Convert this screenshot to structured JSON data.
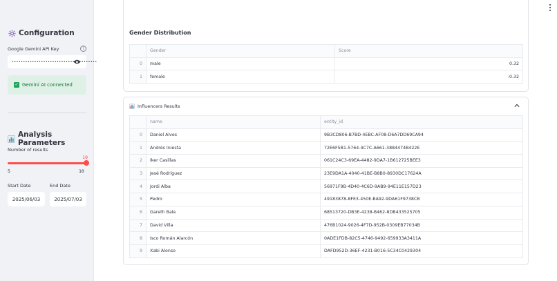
{
  "sidebar": {
    "config_title": "Configuration",
    "config_icon": "gear-icon",
    "api_label": "Google Gemini API Key",
    "api_value_masked": "••••••••••••••••••••••••••••••••••••••",
    "status_text": "Gemini AI connected",
    "params_title": "Analysis Parameters",
    "params_icon": "bar-chart-icon",
    "results_label": "Number of results",
    "results_value": "10",
    "results_min": "5",
    "results_max": "10",
    "start_label": "Start Date",
    "start_value": "2025/06/03",
    "end_label": "End Date",
    "end_value": "2025/07/03"
  },
  "gender": {
    "title": "Gender Distribution",
    "columns": [
      "",
      "Gender",
      "Score"
    ],
    "rows": [
      {
        "idx": "0",
        "gender": "male",
        "score": "0.32"
      },
      {
        "idx": "1",
        "gender": "female",
        "score": "-0.32"
      }
    ]
  },
  "influencers": {
    "title": "Influencers Results",
    "columns": [
      "",
      "name",
      "entity_id"
    ],
    "rows": [
      {
        "idx": "0",
        "name": "Daniel Alves",
        "id": "9B3CD806-B7BD-4EBC-AF08-D6A7DD69CA94"
      },
      {
        "idx": "1",
        "name": "Andrés Iniesta",
        "id": "72E6F5B1-5764-4C7C-A661-3884474B422E"
      },
      {
        "idx": "2",
        "name": "Iker Casillas",
        "id": "061C24C3-69EA-4482-9DA7-1B612725BEE3"
      },
      {
        "idx": "3",
        "name": "Jesé Rodríguez",
        "id": "23E9DA1A-4040-41BE-B8B0-8930DC17624A"
      },
      {
        "idx": "4",
        "name": "Jordi Alba",
        "id": "56971F9B-4D40-4C6D-9AB9-94E11E157D23"
      },
      {
        "idx": "5",
        "name": "Pedro",
        "id": "49183878-8FE3-450E-BA92-9DA61F9738CB"
      },
      {
        "idx": "6",
        "name": "Gareth Bale",
        "id": "68513720-DB3E-4238-B462-8DB433525705"
      },
      {
        "idx": "7",
        "name": "David Villa",
        "id": "476B1024-9026-4F7D-952B-0309EB77034B"
      },
      {
        "idx": "8",
        "name": "Isco Román Alarcón",
        "id": "0ADE1FDB-82C5-4746-9492-659933A3411A"
      },
      {
        "idx": "9",
        "name": "Xabi Alonso",
        "id": "DAFD952D-36EF-4231-B016-5C34C0429304"
      }
    ]
  },
  "colors": {
    "accent": "#ff4b4b",
    "success_bg": "#dff1e6",
    "success_text": "#177233",
    "sidebar_bg": "#f0f2f6"
  }
}
